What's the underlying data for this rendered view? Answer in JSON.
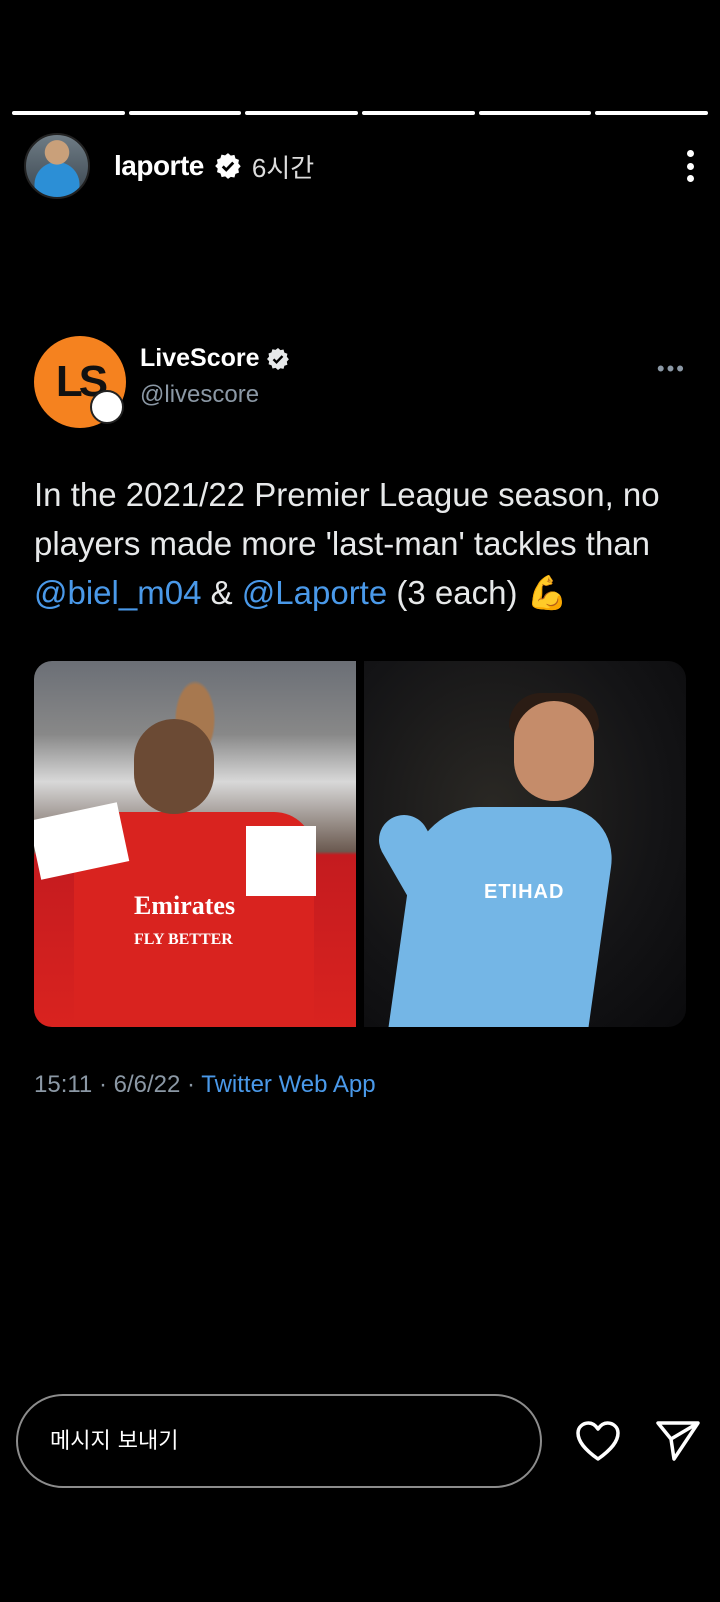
{
  "story": {
    "progress_segments": 6,
    "progress_done": 6,
    "username": "laporte",
    "time": "6시간",
    "verified": true
  },
  "tweet": {
    "author_name": "LiveScore",
    "author_handle": "@livescore",
    "logo_text": "LS",
    "text_parts": {
      "p1": "In the 2021/22 Premier League season, no players made more 'last-man' tackles than ",
      "mention1": "@biel_m04",
      "p2": " & ",
      "mention2": "@Laporte",
      "p3": " (3 each) ",
      "emoji": "💪"
    },
    "image_left_sponsor": "Emirates",
    "image_left_sponsor_sub": "FLY BETTER",
    "image_right_sponsor": "ETIHAD",
    "time": "15:11 · 6/6/22 · ",
    "source": "Twitter Web App"
  },
  "footer": {
    "message_placeholder": "메시지 보내기",
    "like_icon": "heart-icon",
    "send_icon": "send-icon"
  },
  "colors": {
    "background": "#000000",
    "mention": "#4a99e9",
    "muted": "#8b98a5",
    "livescore_orange": "#f5821f"
  }
}
